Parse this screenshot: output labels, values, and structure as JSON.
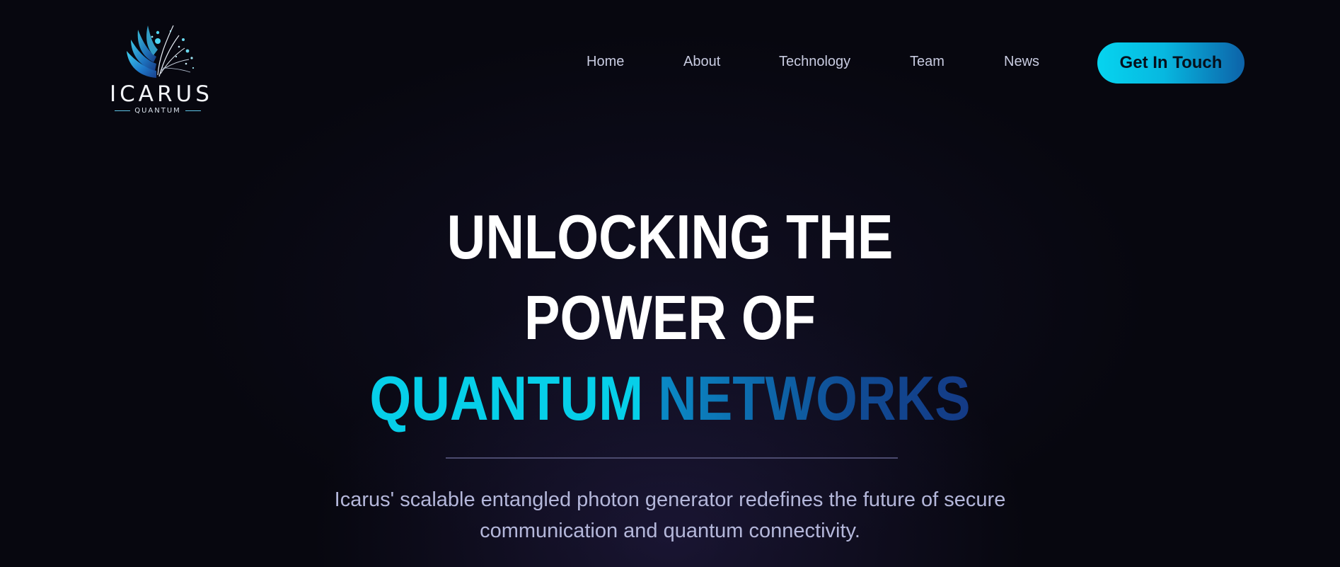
{
  "brand": {
    "name": "ICARUS",
    "tagline": "QUANTUM"
  },
  "nav": {
    "items": [
      {
        "label": "Home"
      },
      {
        "label": "About"
      },
      {
        "label": "Technology"
      },
      {
        "label": "Team"
      },
      {
        "label": "News"
      }
    ],
    "cta_label": "Get In Touch"
  },
  "hero": {
    "title_line1": "UNLOCKING THE",
    "title_line2": "POWER OF",
    "title_accent1": "QUANTUM",
    "title_accent2": "NETWORKS",
    "description": "Icarus' scalable entangled photon generator redefines the future of secure communication and quantum connectivity."
  },
  "colors": {
    "background": "#07070f",
    "accent_cyan": "#06cfe9",
    "accent_blue": "#104d95",
    "nav_text": "#c8cbe0",
    "description_text": "#b4b7da"
  }
}
